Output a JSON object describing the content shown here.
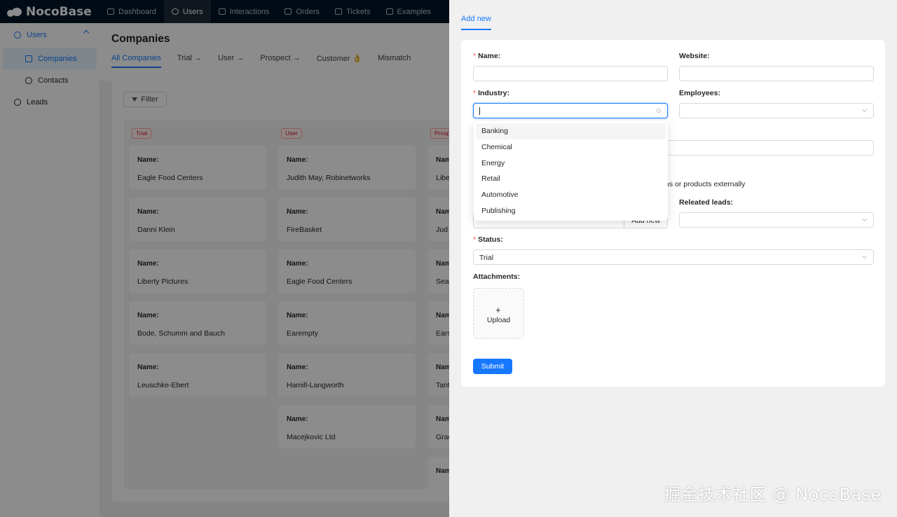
{
  "app": {
    "brand": "NocoBase"
  },
  "topnav": {
    "items": [
      {
        "label": "Dashboard",
        "icon": "dashboard-icon"
      },
      {
        "label": "Users",
        "icon": "users-icon",
        "active": true
      },
      {
        "label": "Interactions",
        "icon": "table-icon"
      },
      {
        "label": "Orders",
        "icon": "orders-icon"
      },
      {
        "label": "Tickets",
        "icon": "ticket-icon"
      },
      {
        "label": "Examples",
        "icon": "bank-icon"
      }
    ]
  },
  "sidebar": {
    "group": "Users",
    "items": [
      {
        "label": "Companies",
        "selected": true
      },
      {
        "label": "Contacts"
      },
      {
        "label": "Leads"
      }
    ]
  },
  "page": {
    "title": "Companies",
    "tabs": [
      "All Companies",
      "Trial →",
      "User →",
      "Prospect →",
      "Customer 👌",
      "Mismatch"
    ],
    "filter_label": "Filter"
  },
  "kanban": {
    "columns": [
      {
        "tag": "Trial",
        "cards": [
          "Eagle Food Centers",
          "Danni Klein",
          "Liberty Pictures",
          "Bode, Schumm and Bauch",
          "Leuschke-Ebert"
        ]
      },
      {
        "tag": "User",
        "cards": [
          "Judith May, Robinetworks",
          "FireBasket",
          "Eagle Food Centers",
          "Earempty",
          "Hamill-Langworth",
          "Macejkovic Ltd"
        ]
      },
      {
        "tag": "Prosp",
        "cards": [
          "Libe",
          "Jud",
          "Sea",
          "Ears",
          "Tant",
          "Grac",
          ""
        ]
      }
    ],
    "card_label": "Name"
  },
  "drawer": {
    "tab": "Add new",
    "fields": {
      "name": {
        "label": "Name",
        "required": true,
        "value": ""
      },
      "website": {
        "label": "Website",
        "value": ""
      },
      "industry": {
        "label": "Industry",
        "required": true,
        "value": ""
      },
      "employees": {
        "label": "Employees",
        "value": ""
      },
      "description_partial": "ns or products externally",
      "related_leads": {
        "label": "Releated leads",
        "value": ""
      },
      "add_new_label": "Add new",
      "status": {
        "label": "Status",
        "required": true,
        "value": "Trial"
      },
      "attachments": {
        "label": "Attachments",
        "upload_label": "Upload"
      }
    },
    "industry_options": [
      "Banking",
      "Chemical",
      "Energy",
      "Retail",
      "Automotive",
      "Publishing"
    ],
    "submit_label": "Submit"
  },
  "watermark": "掘金技术社区 @ NocoBase",
  "colors": {
    "primary": "#1677ff",
    "topbar": "#001529",
    "danger": "#ff4d4f"
  }
}
